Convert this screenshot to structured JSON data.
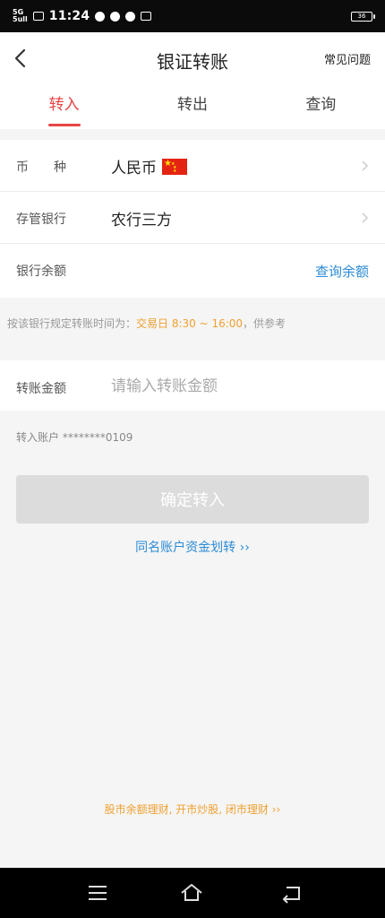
{
  "status_bar": {
    "signal_top": "5G",
    "signal_bottom": "5ull",
    "time": "11:24",
    "battery": "36"
  },
  "header": {
    "title": "银证转账",
    "faq_label": "常见问题"
  },
  "tabs": [
    {
      "label": "转入",
      "active": true
    },
    {
      "label": "转出",
      "active": false
    },
    {
      "label": "查询",
      "active": false
    }
  ],
  "info": {
    "currency_label": "币种",
    "currency_value": "人民币",
    "bank_label": "存管银行",
    "bank_value": "农行三方",
    "balance_label": "银行余额",
    "balance_action": "查询余额"
  },
  "notice": {
    "prefix": "按该银行规定转账时间为：",
    "highlight": "交易日 8:30 ~ 16:00",
    "suffix": "，供参考"
  },
  "amount": {
    "label": "转账金额",
    "placeholder": "请输入转账金额",
    "value": ""
  },
  "account": {
    "label": "转入账户",
    "number": "********0109"
  },
  "confirm_label": "确定转入",
  "same_name_link": "同名账户资金划转 ››",
  "promo_link": "股市余额理财, 开市炒股, 闭市理财 ››",
  "colors": {
    "accent_red": "#e84545",
    "link_blue": "#2b8bd6",
    "highlight_orange": "#f0a030"
  }
}
